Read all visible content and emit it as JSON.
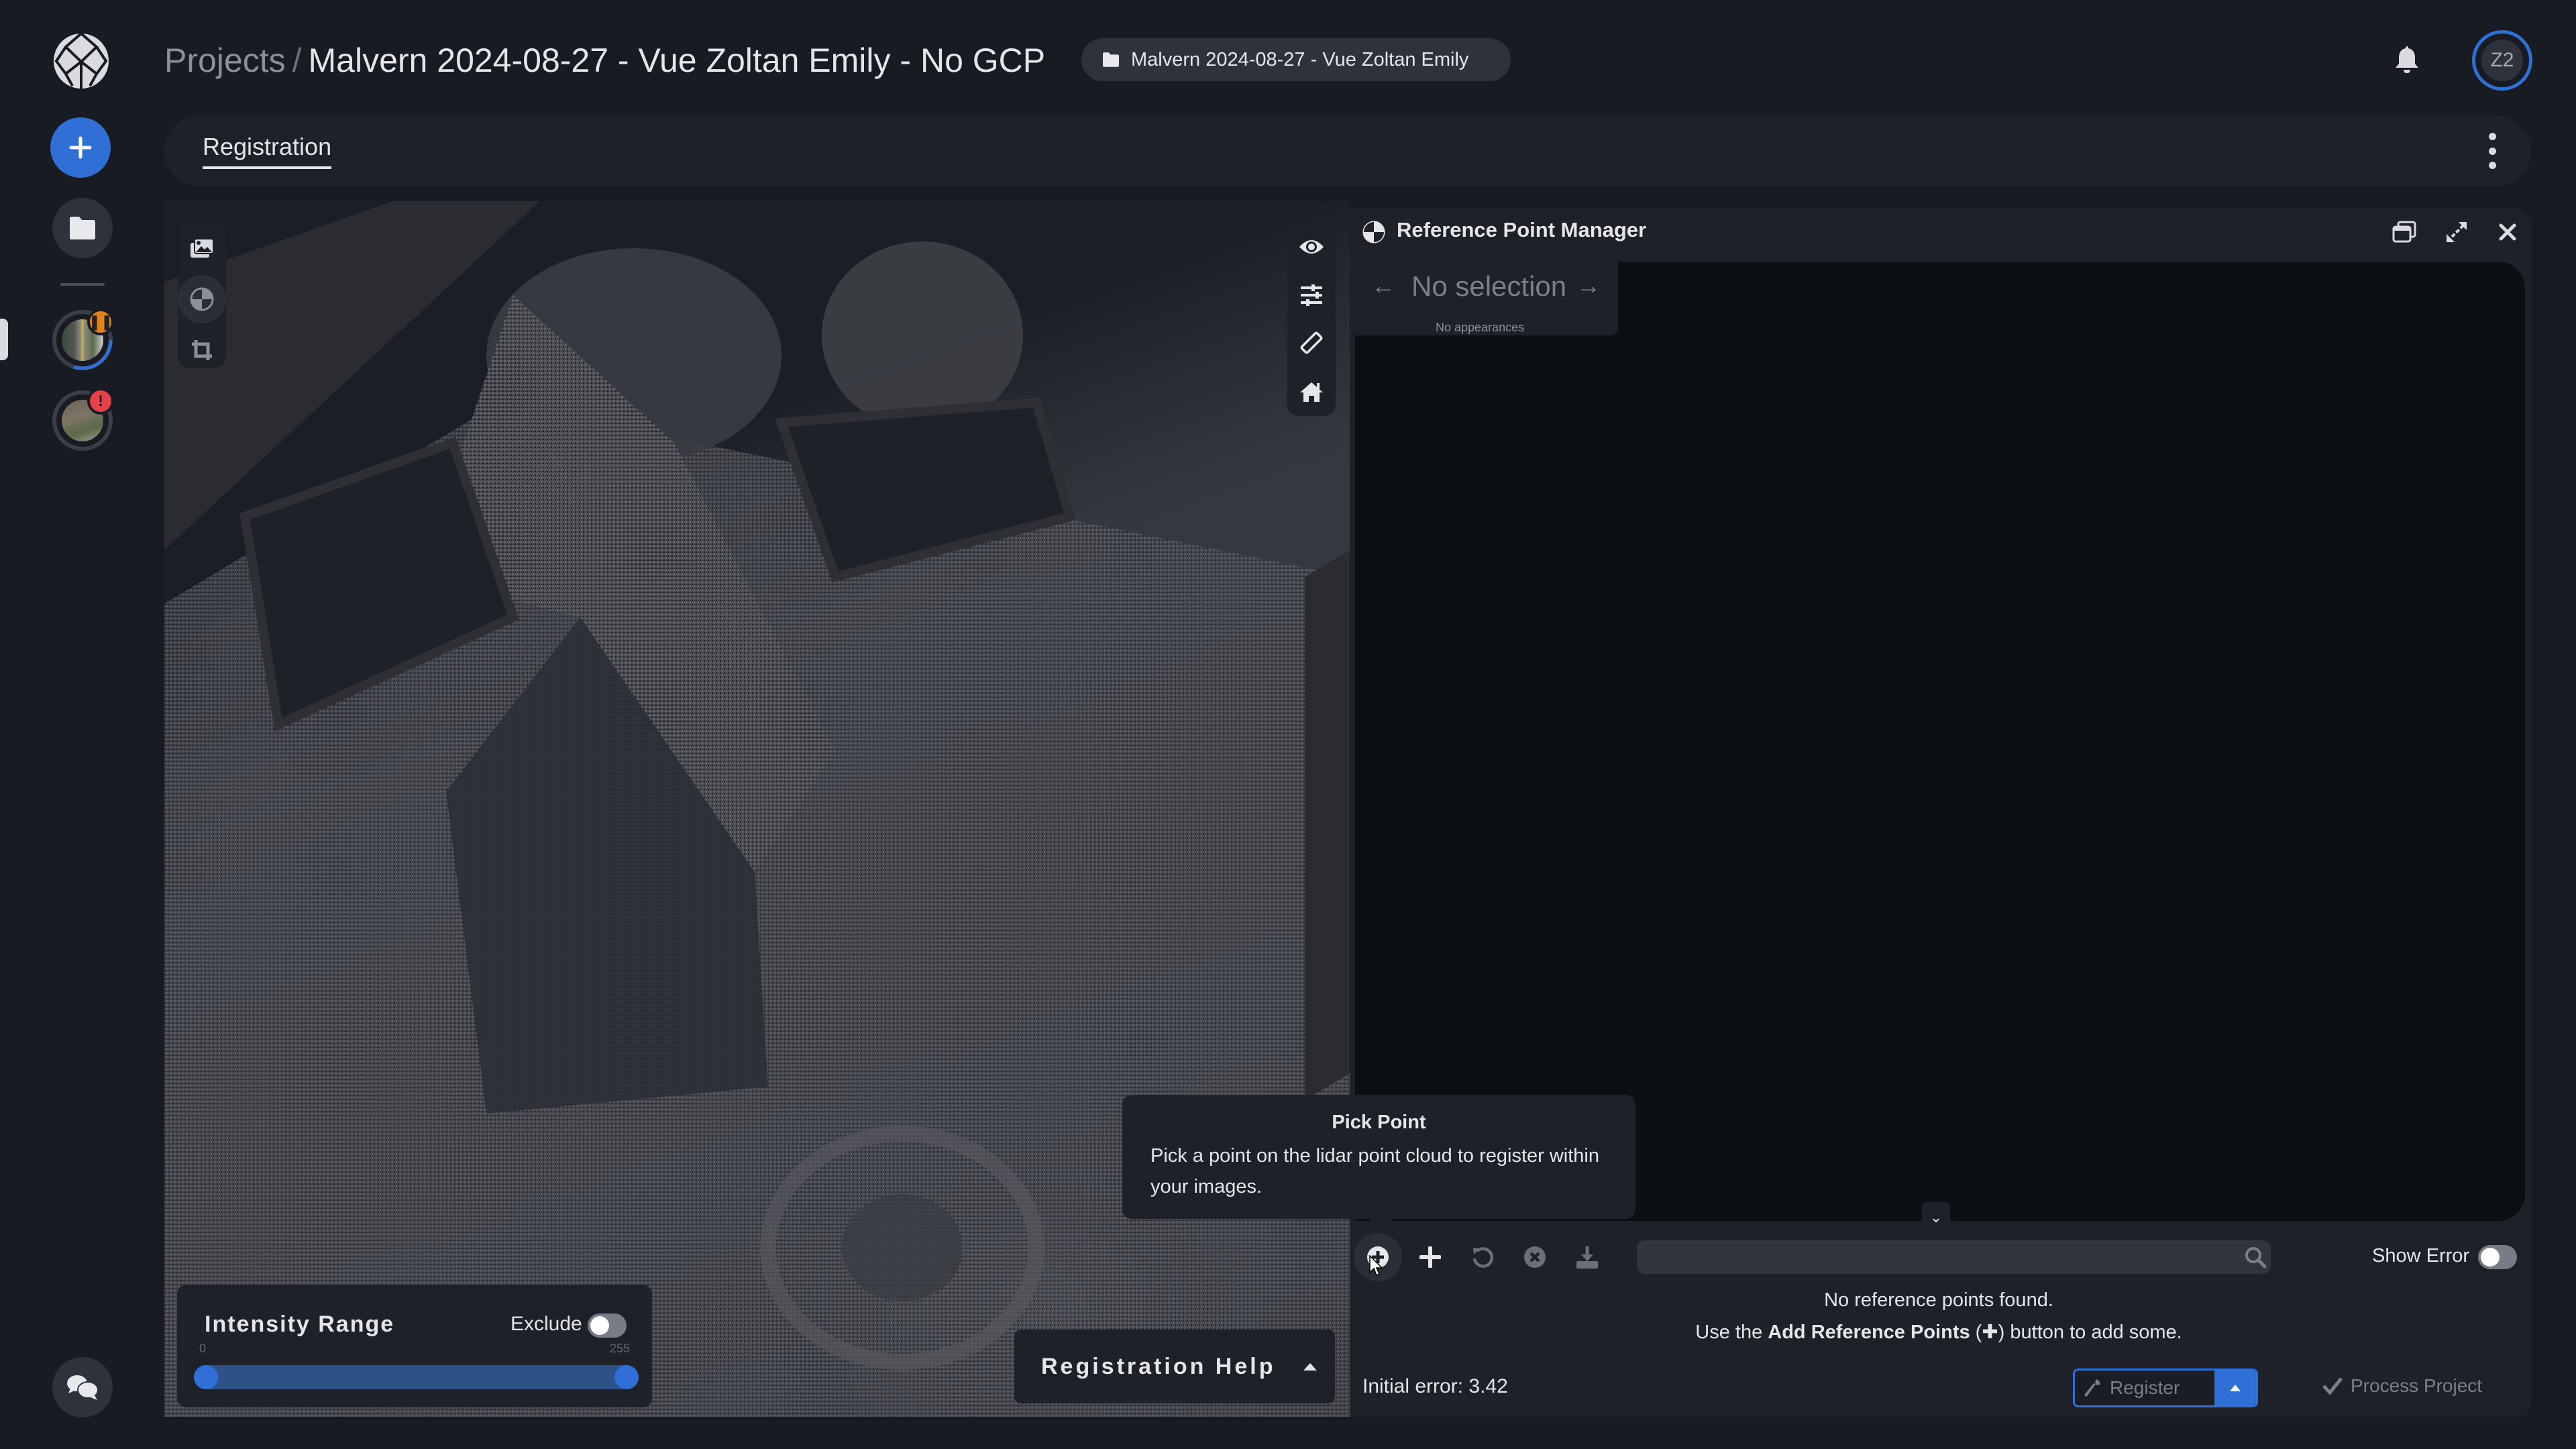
{
  "header": {
    "breadcrumb_root": "Projects",
    "breadcrumb_separator": "/",
    "project_title": "Malvern 2024-08-27 - Vue Zoltan Emily - No GCP",
    "folder_chip": "Malvern 2024-08-27 - Vue Zoltan Emily",
    "avatar_initials": "Z2"
  },
  "sidebar": {
    "items": [
      {
        "name": "logo",
        "icon": "logo-icon"
      },
      {
        "name": "new",
        "icon": "plus-icon"
      },
      {
        "name": "projects",
        "icon": "folder-icon"
      },
      {
        "name": "project-thumb-1",
        "badge": "pause",
        "progress": 0.3
      },
      {
        "name": "project-thumb-2",
        "badge": "!"
      },
      {
        "name": "chat",
        "icon": "chat-icon"
      }
    ]
  },
  "tabs": [
    {
      "label": "Registration",
      "active": true
    }
  ],
  "viewport": {
    "left_tools": [
      "images-icon",
      "reference-point-icon",
      "crop-icon"
    ],
    "right_tools": [
      "eye-icon",
      "sliders-icon",
      "ruler-icon",
      "home-icon"
    ],
    "intensity": {
      "title": "Intensity Range",
      "exclude_label": "Exclude",
      "exclude_on": false,
      "min": "0",
      "max": "255",
      "range_low": 0,
      "range_high": 255
    },
    "registration_help": "Registration Help"
  },
  "ref_panel": {
    "title": "Reference Point Manager",
    "selection": "No selection",
    "appearances": "No appearances",
    "tooltip": {
      "title": "Pick Point",
      "body": "Pick a point on the lidar point cloud to register within your images."
    },
    "toolbar": [
      "pick-point-icon",
      "add-icon",
      "undo-icon",
      "clear-icon",
      "download-icon"
    ],
    "search_placeholder": "",
    "search_value": "",
    "show_error_label": "Show Error",
    "show_error_on": false,
    "empty_line1": "No reference points found.",
    "empty_line2_pre": "Use the ",
    "empty_line2_bold": "Add Reference Points",
    "empty_line2_post": " button to add some.",
    "initial_error": "Initial error: 3.42",
    "register_label": "Register",
    "process_label": "Process Project"
  },
  "colors": {
    "accent": "#2f6fd6",
    "background": "#181b22",
    "panel": "#1f2129",
    "pause_badge": "#e0821e",
    "alert_badge": "#e5414b"
  }
}
